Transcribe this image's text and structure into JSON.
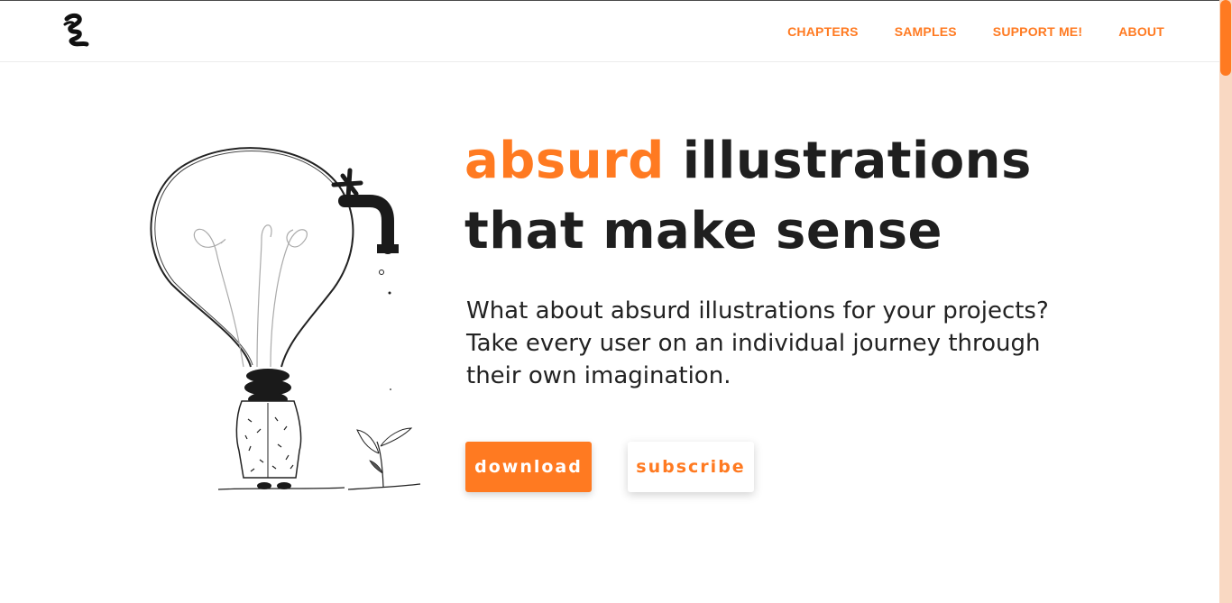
{
  "nav": {
    "items": [
      {
        "label": "CHAPTERS"
      },
      {
        "label": "SAMPLES"
      },
      {
        "label": "SUPPORT ME!"
      },
      {
        "label": "ABOUT"
      }
    ]
  },
  "hero": {
    "headline_accent": "absurd",
    "headline_rest_line1": " illustrations",
    "headline_line2": "that make sense",
    "lede_line1": "What about absurd illustrations for your projects?",
    "lede_line2": "Take every user on an individual journey through",
    "lede_line3": "their own imagination.",
    "primary_button": "download",
    "secondary_button": "subscribe"
  },
  "colors": {
    "accent": "#ff7a21",
    "text": "#1f1f1f",
    "scrollbar_track": "#f9d8c2"
  },
  "icons": {
    "logo": "scribble-logo-icon",
    "illustration": "lightbulb-person-illustration"
  }
}
